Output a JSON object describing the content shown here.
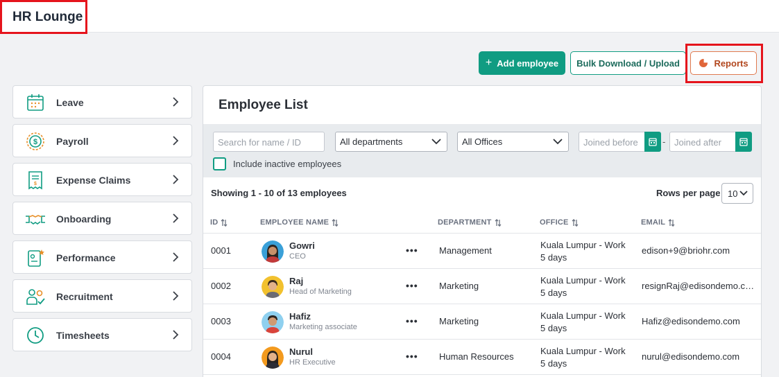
{
  "app": {
    "title": "HR Lounge"
  },
  "actions": {
    "add_employee": "Add employee",
    "bulk": "Bulk Download / Upload",
    "reports": "Reports"
  },
  "sidebar": {
    "items": [
      {
        "label": "Leave",
        "icon": "calendar-icon"
      },
      {
        "label": "Payroll",
        "icon": "dollar-coin-icon"
      },
      {
        "label": "Expense Claims",
        "icon": "receipt-icon"
      },
      {
        "label": "Onboarding",
        "icon": "handshake-icon"
      },
      {
        "label": "Performance",
        "icon": "clipboard-star-icon"
      },
      {
        "label": "Recruitment",
        "icon": "users-check-icon"
      },
      {
        "label": "Timesheets",
        "icon": "clock-icon"
      }
    ]
  },
  "panel": {
    "title": "Employee List",
    "filters": {
      "search_placeholder": "Search for name / ID",
      "department": "All departments",
      "office": "All Offices",
      "joined_before": "Joined before",
      "joined_after": "Joined after",
      "separator": "-",
      "include_inactive": "Include inactive employees"
    },
    "showing": "Showing 1 - 10 of 13 employees",
    "rows_per_page_label": "Rows per page",
    "rows_per_page": "10",
    "columns": {
      "id": "ID",
      "name": "EMPLOYEE NAME",
      "department": "DEPARTMENT",
      "office": "OFFICE",
      "email": "EMAIL"
    },
    "rows": [
      {
        "id": "0001",
        "name": "Gowri",
        "title": "CEO",
        "department": "Management",
        "office": "Kuala Lumpur - Work 5 days",
        "email": "edison+9@briohr.com",
        "more": "•••"
      },
      {
        "id": "0002",
        "name": "Raj",
        "title": "Head of Marketing",
        "department": "Marketing",
        "office": "Kuala Lumpur - Work 5 days",
        "email": "resignRaj@edisondemo.com",
        "more": "•••"
      },
      {
        "id": "0003",
        "name": "Hafiz",
        "title": "Marketing associate",
        "department": "Marketing",
        "office": "Kuala Lumpur - Work 5 days",
        "email": "Hafiz@edisondemo.com",
        "more": "•••"
      },
      {
        "id": "0004",
        "name": "Nurul",
        "title": "HR Executive",
        "department": "Human Resources",
        "office": "Kuala Lumpur - Work 5 days",
        "email": "nurul@edisondemo.com",
        "more": "•••"
      }
    ]
  },
  "colors": {
    "accent": "#109c82",
    "reports": "#b2471e",
    "highlight": "#e5141c"
  }
}
